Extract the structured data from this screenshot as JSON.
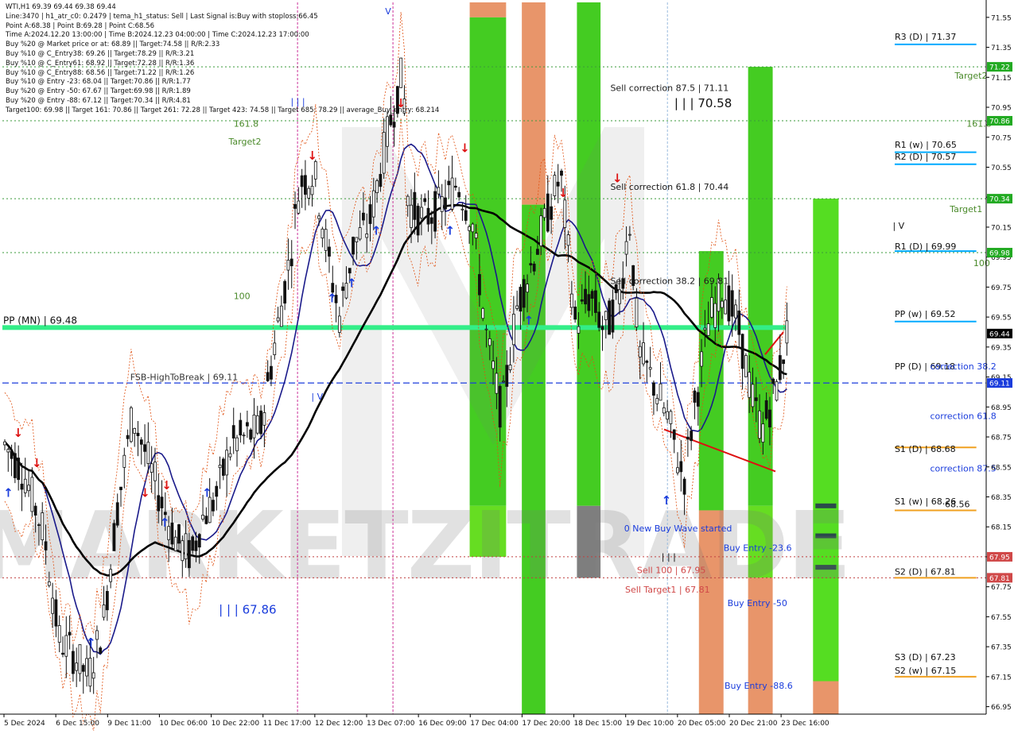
{
  "header": {
    "symbol": "WTI,H1  69.39 69.44 69.38 69.44",
    "info_lines": [
      "Line:3470  |  h1_atr_c0: 0.2479  |  tema_h1_status: Sell  |  Last Signal is:Buy with stoploss:66.45",
      "Point A:68.38  |  Point B:69.28  |  Point C:68.56",
      "Time A:2024.12.20 13:00:00  |  Time B:2024.12.23 04:00:00  |  Time C:2024.12.23 17:00:00",
      "Buy %20 @ Market price or at: 68.89  ||  Target:74.58  ||  R/R:2.33",
      "Buy %10 @ C_Entry38: 69.26  ||  Target:78.29  ||  R/R:3.21",
      "Buy %10 @ C_Entry61: 68.92  ||  Target:72.28  ||  R/R:1.36",
      "Buy %10 @ C_Entry88: 68.56  ||  Target:71.22  ||  R/R:1.26",
      "Buy %10 @ Entry -23: 68.04  ||  Target:70.86  ||  R/R:1.77",
      "Buy %20 @ Entry -50: 67.67  ||  Target:69.98  ||  R/R:1.89",
      "Buy %20 @ Entry -88: 67.12  ||  Target:70.34  ||  R/R:4.81",
      "Target100: 69.98  ||  Target 161: 70.86  ||  Target 261: 72.28  ||  Target 423: 74.58  ||  Target 685: 78.29  ||  average_Buy_entry: 68.214"
    ]
  },
  "chart_data": {
    "type": "candlestick",
    "symbol": "WTI",
    "timeframe": "H1",
    "ylim": [
      66.9,
      71.65
    ],
    "y_ticks": [
      66.95,
      67.15,
      67.35,
      67.55,
      67.75,
      67.95,
      68.15,
      68.35,
      68.55,
      68.75,
      68.95,
      69.15,
      69.35,
      69.55,
      69.75,
      69.95,
      70.15,
      70.35,
      70.55,
      70.75,
      70.95,
      71.15,
      71.35,
      71.55
    ],
    "x_labels": [
      "5 Dec 2024",
      "6 Dec 15:00",
      "9 Dec 11:00",
      "10 Dec 06:00",
      "10 Dec 22:00",
      "11 Dec 17:00",
      "12 Dec 12:00",
      "13 Dec 07:00",
      "16 Dec 09:00",
      "17 Dec 04:00",
      "17 Dec 20:00",
      "18 Dec 15:00",
      "19 Dec 10:00",
      "20 Dec 05:00",
      "20 Dec 21:00",
      "23 Dec 16:00"
    ],
    "price_tags": [
      {
        "value": 71.22,
        "label": "71.22",
        "color": "#22aa22"
      },
      {
        "value": 70.86,
        "label": "70.86",
        "color": "#22aa22"
      },
      {
        "value": 70.34,
        "label": "70.34",
        "color": "#22aa22"
      },
      {
        "value": 69.98,
        "label": "69.98",
        "color": "#22aa22"
      },
      {
        "value": 69.44,
        "label": "69.44",
        "color": "#000000"
      },
      {
        "value": 69.11,
        "label": "69.11",
        "color": "#1a3cdc"
      },
      {
        "value": 67.95,
        "label": "67.95",
        "color": "#d04848"
      },
      {
        "value": 67.81,
        "label": "67.81",
        "color": "#d04848"
      }
    ],
    "horizontal_lines": [
      {
        "value": 71.22,
        "color": "#3a9a3a",
        "style": "dotted"
      },
      {
        "value": 70.86,
        "color": "#3a9a3a",
        "style": "dotted"
      },
      {
        "value": 70.34,
        "color": "#3a9a3a",
        "style": "dotted"
      },
      {
        "value": 69.98,
        "color": "#3a9a3a",
        "style": "dotted"
      },
      {
        "value": 69.11,
        "color": "#1a3cdc",
        "style": "dashed"
      },
      {
        "value": 67.95,
        "color": "#c04040",
        "style": "dotted"
      },
      {
        "value": 67.81,
        "color": "#c04040",
        "style": "dotted"
      }
    ],
    "pivot_line": {
      "value": 69.48,
      "label": "PP (MN) | 69.48",
      "color": "#33ee88"
    },
    "annotations": [
      {
        "text": "FSB-HighToBreak | 69.11",
        "x": 0.13,
        "y": 69.13,
        "color": "#333333"
      },
      {
        "text": "161.8",
        "x": 0.235,
        "y": 70.82,
        "color": "#4a8a2a"
      },
      {
        "text": "Target2",
        "x": 0.23,
        "y": 70.7,
        "color": "#4a8a2a"
      },
      {
        "text": "100",
        "x": 0.235,
        "y": 69.67,
        "color": "#4a8a2a"
      },
      {
        "text": "| | | 67.86",
        "x": 0.22,
        "y": 67.57,
        "color": "#1a3cdc"
      },
      {
        "text": "Sell correction 87.5 | 71.11",
        "x": 0.618,
        "y": 71.06,
        "color": "#1a1a1a"
      },
      {
        "text": "| | | 70.58",
        "x": 0.683,
        "y": 70.95,
        "color": "#111111"
      },
      {
        "text": "Sell correction 61.8 | 70.44",
        "x": 0.618,
        "y": 70.4,
        "color": "#1a1a1a"
      },
      {
        "text": "Sell correction 38.2 | 69.81",
        "x": 0.618,
        "y": 69.77,
        "color": "#1a1a1a"
      },
      {
        "text": "Sell 100 | 67.95",
        "x": 0.645,
        "y": 67.84,
        "color": "#d04848"
      },
      {
        "text": "Sell Target1 | 67.81",
        "x": 0.633,
        "y": 67.71,
        "color": "#d04848"
      },
      {
        "text": "R3 (D) | 71.37",
        "x": 0.907,
        "y": 71.4,
        "color": "#111111"
      },
      {
        "text": "Target2",
        "x": 0.968,
        "y": 71.14,
        "color": "#4a8a2a"
      },
      {
        "text": "161.8",
        "x": 0.98,
        "y": 70.82,
        "color": "#4a8a2a"
      },
      {
        "text": "R1 (w) | 70.65",
        "x": 0.907,
        "y": 70.68,
        "color": "#111111"
      },
      {
        "text": "R2 (D) | 70.57",
        "x": 0.907,
        "y": 70.6,
        "color": "#111111"
      },
      {
        "text": "Target1",
        "x": 0.963,
        "y": 70.25,
        "color": "#4a8a2a"
      },
      {
        "text": "| V",
        "x": 0.905,
        "y": 70.14,
        "color": "#111111"
      },
      {
        "text": "R1 (D) | 69.99",
        "x": 0.907,
        "y": 70.0,
        "color": "#111111"
      },
      {
        "text": "100",
        "x": 0.987,
        "y": 69.89,
        "color": "#4a8a2a"
      },
      {
        "text": "PP (w) | 69.52",
        "x": 0.907,
        "y": 69.55,
        "color": "#111111"
      },
      {
        "text": "PP (D) | 69.18",
        "x": 0.907,
        "y": 69.2,
        "color": "#111111"
      },
      {
        "text": "correction 38.2",
        "x": 0.943,
        "y": 69.2,
        "color": "#1a3cdc"
      },
      {
        "text": "correction 61.8",
        "x": 0.943,
        "y": 68.87,
        "color": "#1a3cdc"
      },
      {
        "text": "S1 (D) | 68.68",
        "x": 0.907,
        "y": 68.65,
        "color": "#111111"
      },
      {
        "text": "correction 87.5",
        "x": 0.943,
        "y": 68.52,
        "color": "#1a3cdc"
      },
      {
        "text": "S1 (w) | 68.26",
        "x": 0.907,
        "y": 68.3,
        "color": "#111111"
      },
      {
        "text": "68.56",
        "x": 0.958,
        "y": 68.28,
        "color": "#111111"
      },
      {
        "text": "0 New Buy Wave started",
        "x": 0.632,
        "y": 68.12,
        "color": "#1a3cdc"
      },
      {
        "text": "| | |",
        "x": 0.67,
        "y": 67.93,
        "color": "#111111"
      },
      {
        "text": "Buy Entry -23.6",
        "x": 0.733,
        "y": 67.99,
        "color": "#1a3cdc"
      },
      {
        "text": "S2 (D) | 67.81",
        "x": 0.907,
        "y": 67.83,
        "color": "#111111"
      },
      {
        "text": "Buy Entry -50",
        "x": 0.737,
        "y": 67.62,
        "color": "#1a3cdc"
      },
      {
        "text": "S3 (D) | 67.23",
        "x": 0.907,
        "y": 67.26,
        "color": "#111111"
      },
      {
        "text": "S2 (w) | 67.15",
        "x": 0.907,
        "y": 67.17,
        "color": "#111111"
      },
      {
        "text": "Buy Entry -88.6",
        "x": 0.734,
        "y": 67.07,
        "color": "#1a3cdc"
      },
      {
        "text": "V",
        "x": 0.389,
        "y": 71.57,
        "color": "#1a3cdc"
      },
      {
        "text": "| | |",
        "x": 0.293,
        "y": 70.97,
        "color": "#1a3cdc"
      },
      {
        "text": "| V",
        "x": 0.314,
        "y": 69.0,
        "color": "#1a3cdc"
      }
    ],
    "level_lines": [
      {
        "value": 71.37,
        "x0": 0.907,
        "x1": 0.99,
        "color": "#00aaff"
      },
      {
        "value": 70.65,
        "x0": 0.907,
        "x1": 0.99,
        "color": "#00aaff"
      },
      {
        "value": 70.57,
        "x0": 0.907,
        "x1": 0.99,
        "color": "#00aaff"
      },
      {
        "value": 69.99,
        "x0": 0.907,
        "x1": 0.99,
        "color": "#00aaff"
      },
      {
        "value": 69.52,
        "x0": 0.907,
        "x1": 0.99,
        "color": "#00aaff"
      },
      {
        "value": 68.68,
        "x0": 0.907,
        "x1": 0.99,
        "color": "#f0a020"
      },
      {
        "value": 68.26,
        "x0": 0.907,
        "x1": 0.99,
        "color": "#f0a020"
      },
      {
        "value": 67.81,
        "x0": 0.907,
        "x1": 0.99,
        "color": "#f0a020"
      },
      {
        "value": 67.15,
        "x0": 0.907,
        "x1": 0.99,
        "color": "#f0a020"
      }
    ],
    "zones": [
      {
        "x0": 0.475,
        "x1": 0.512,
        "y0": 71.7,
        "y1": 71.55,
        "color": "#e8956a"
      },
      {
        "x0": 0.475,
        "x1": 0.512,
        "y0": 71.55,
        "y1": 68.29,
        "color": "#44cc22"
      },
      {
        "x0": 0.475,
        "x1": 0.512,
        "y0": 68.29,
        "y1": 67.95,
        "color": "#66dd22"
      },
      {
        "x0": 0.528,
        "x1": 0.552,
        "y0": 71.7,
        "y1": 70.3,
        "color": "#e8956a"
      },
      {
        "x0": 0.528,
        "x1": 0.552,
        "y0": 70.3,
        "y1": 66.9,
        "color": "#44cc22"
      },
      {
        "x0": 0.584,
        "x1": 0.608,
        "y0": 71.7,
        "y1": 68.29,
        "color": "#44cc22"
      },
      {
        "x0": 0.584,
        "x1": 0.608,
        "y0": 68.29,
        "y1": 67.81,
        "color": "#808080"
      },
      {
        "x0": 0.708,
        "x1": 0.733,
        "y0": 69.99,
        "y1": 68.26,
        "color": "#44cc22"
      },
      {
        "x0": 0.708,
        "x1": 0.733,
        "y0": 68.26,
        "y1": 66.9,
        "color": "#e8956a"
      },
      {
        "x0": 0.758,
        "x1": 0.783,
        "y0": 71.22,
        "y1": 68.29,
        "color": "#44cc22"
      },
      {
        "x0": 0.758,
        "x1": 0.783,
        "y0": 68.29,
        "y1": 67.81,
        "color": "#66dd22"
      },
      {
        "x0": 0.758,
        "x1": 0.783,
        "y0": 67.81,
        "y1": 66.9,
        "color": "#e8956a"
      },
      {
        "x0": 0.824,
        "x1": 0.85,
        "y0": 70.34,
        "y1": 67.12,
        "color": "#55dd22"
      },
      {
        "x0": 0.824,
        "x1": 0.85,
        "y0": 67.12,
        "y1": 66.9,
        "color": "#e8956a"
      }
    ],
    "wave_markers": [
      {
        "y": 68.29,
        "color": "#2a4a4a"
      },
      {
        "y": 68.09,
        "color": "#2a4a4a"
      },
      {
        "y": 67.88,
        "color": "#2a4a4a"
      }
    ],
    "vlines": [
      {
        "x": 0.3,
        "color": "#cc3399"
      },
      {
        "x": 0.397,
        "color": "#cc3399"
      },
      {
        "x": 0.676,
        "color": "#99bbdd"
      }
    ],
    "watermark": "MARKETZITRADE",
    "current_price": 69.44
  }
}
